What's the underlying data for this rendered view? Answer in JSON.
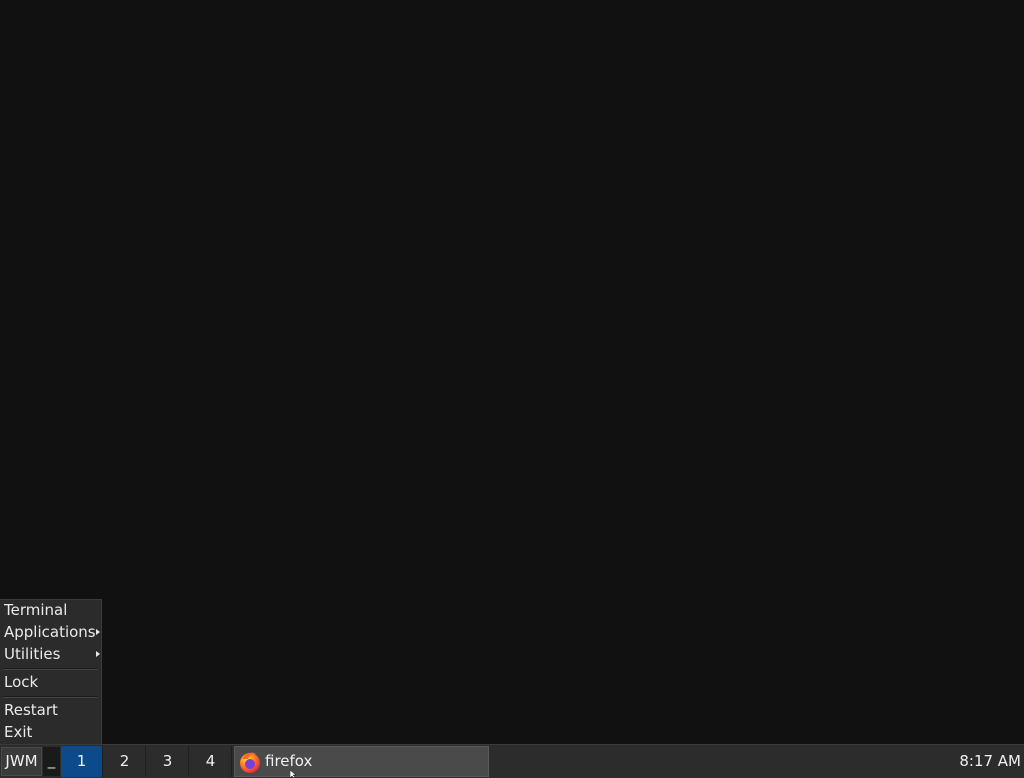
{
  "root_menu": {
    "items": [
      {
        "label": "Terminal",
        "submenu": false
      },
      {
        "label": "Applications",
        "submenu": true
      },
      {
        "label": "Utilities",
        "submenu": true
      },
      {
        "label": "Lock",
        "submenu": false
      },
      {
        "label": "Restart",
        "submenu": false
      },
      {
        "label": "Exit",
        "submenu": false
      }
    ]
  },
  "taskbar": {
    "menu_button_label": "JWM",
    "minimize_label": "_",
    "workspaces": [
      "1",
      "2",
      "3",
      "4"
    ],
    "active_workspace": "1",
    "task": {
      "label": "firefox",
      "icon": "firefox-icon"
    },
    "clock": "8:17 AM"
  },
  "colors": {
    "desktop": "#111111",
    "taskbar": "#2c2c2c",
    "active_workspace": "#0c4a8c",
    "menu": "#2b2b2b"
  }
}
